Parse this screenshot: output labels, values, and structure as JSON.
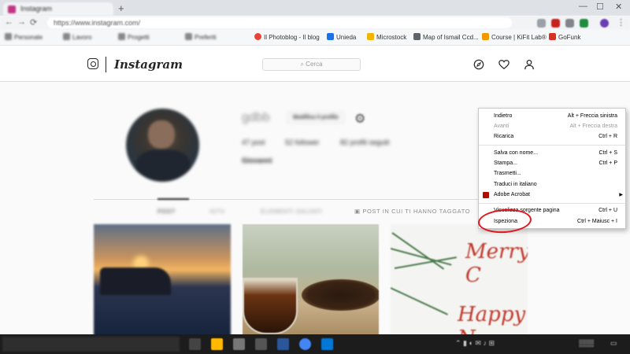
{
  "browser": {
    "tab_title": "Instagram",
    "url": "https://www.instagram.com/",
    "bookmarks": [
      {
        "label": "Il Photoblog - Il blog",
        "color": "#ea4335"
      },
      {
        "label": "Unieda",
        "color": "#1a73e8"
      },
      {
        "label": "Microstock",
        "color": "#f4b400"
      },
      {
        "label": "Map of Ismail Ccd...",
        "color": "#5f6368"
      },
      {
        "label": "Course | KiFit Lab®",
        "color": "#f29900"
      },
      {
        "label": "GoFunk",
        "color": "#d93025"
      }
    ]
  },
  "instagram": {
    "wordmark": "Instagram",
    "search_placeholder": "Cerca",
    "profile": {
      "username": "gdbb",
      "edit_label": "Modifica il profilo",
      "posts": "47 post",
      "followers": "52 follower",
      "following": "82 profili seguiti",
      "full_name": "Giovanni"
    },
    "tabs": [
      "POST",
      "IGTV",
      "ELEMENTI SALVATI",
      "POST IN CUI TI HANNO TAGGATO"
    ]
  },
  "context_menu": {
    "items": [
      {
        "label": "Indietro",
        "shortcut": "Alt + Freccia sinistra",
        "disabled": false
      },
      {
        "label": "Avanti",
        "shortcut": "Alt + Freccia destra",
        "disabled": true
      },
      {
        "label": "Ricarica",
        "shortcut": "Ctrl + R",
        "disabled": false
      },
      {
        "label": "Salva con nome...",
        "shortcut": "Ctrl + S",
        "disabled": false
      },
      {
        "label": "Stampa...",
        "shortcut": "Ctrl + P",
        "disabled": false
      },
      {
        "label": "Trasmetti...",
        "shortcut": "",
        "disabled": false
      },
      {
        "label": "Traduci in italiano",
        "shortcut": "",
        "disabled": false
      },
      {
        "label": "Adobe Acrobat",
        "shortcut": "",
        "disabled": false
      },
      {
        "label": "Visualizza sorgente pagina",
        "shortcut": "Ctrl + U",
        "disabled": false
      },
      {
        "label": "Ispeziona",
        "shortcut": "Ctrl + Maiusc + I",
        "disabled": false
      }
    ],
    "highlight_color": "#e0141e"
  },
  "post3_text": [
    "Merry C",
    "Happy N"
  ],
  "icons": [
    "instagram-logo-icon",
    "compass-icon",
    "heart-icon",
    "user-icon",
    "gear-icon",
    "acrobat-icon",
    "search-icon"
  ]
}
